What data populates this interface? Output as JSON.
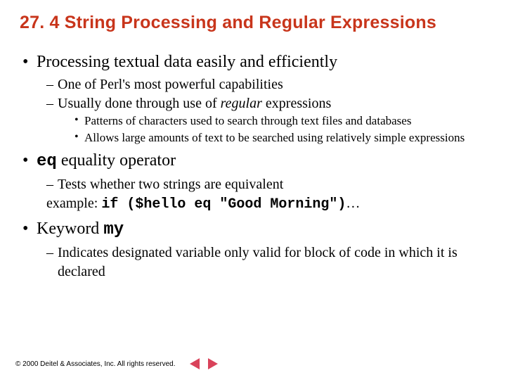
{
  "title": "27. 4 String Processing and Regular Expressions",
  "b1": {
    "text": "Processing textual data easily and efficiently",
    "s1": "One of Perl's most powerful capabilities",
    "s2_a": "Usually done through use of ",
    "s2_b": "regular",
    "s2_c": " expressions",
    "s2_s1": "Patterns of characters used to search through text files and databases",
    "s2_s2": "Allows large amounts of text to be searched using relatively simple expressions"
  },
  "b2": {
    "code": "eq",
    "rest": " equality operator",
    "s1": "Tests whether two strings are equivalent",
    "ex_label": "example: ",
    "ex_code": "if ($hello eq \"Good Morning\")",
    "ex_tail": "…"
  },
  "b3": {
    "pre": "Keyword ",
    "code": "my",
    "s1": "Indicates designated variable only valid for block of code in which it is declared"
  },
  "footer": {
    "copyright": "© 2000 Deitel & Associates, Inc.  All rights reserved."
  }
}
